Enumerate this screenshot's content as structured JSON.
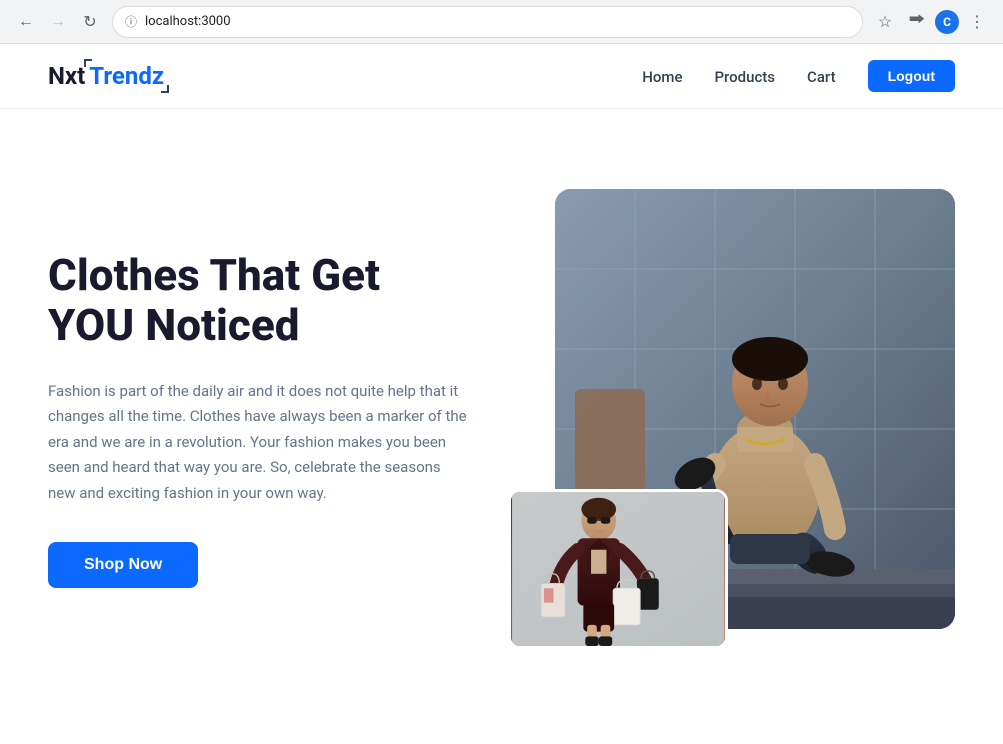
{
  "browser": {
    "url": "localhost:3000",
    "back_disabled": false,
    "forward_disabled": true,
    "profile_initial": "C"
  },
  "navbar": {
    "logo_nxt": "Nxt",
    "logo_trendz": "Trendz",
    "links": [
      {
        "label": "Home",
        "id": "home"
      },
      {
        "label": "Products",
        "id": "products"
      },
      {
        "label": "Cart",
        "id": "cart"
      }
    ],
    "logout_label": "Logout"
  },
  "hero": {
    "title_line1": "Clothes That Get",
    "title_line2": "YOU Noticed",
    "description": "Fashion is part of the daily air and it does not quite help that it changes all the time. Clothes have always been a marker of the era and we are in a revolution. Your fashion makes you been seen and heard that way you are. So, celebrate the seasons new and exciting fashion in your own way.",
    "cta_label": "Shop Now"
  }
}
